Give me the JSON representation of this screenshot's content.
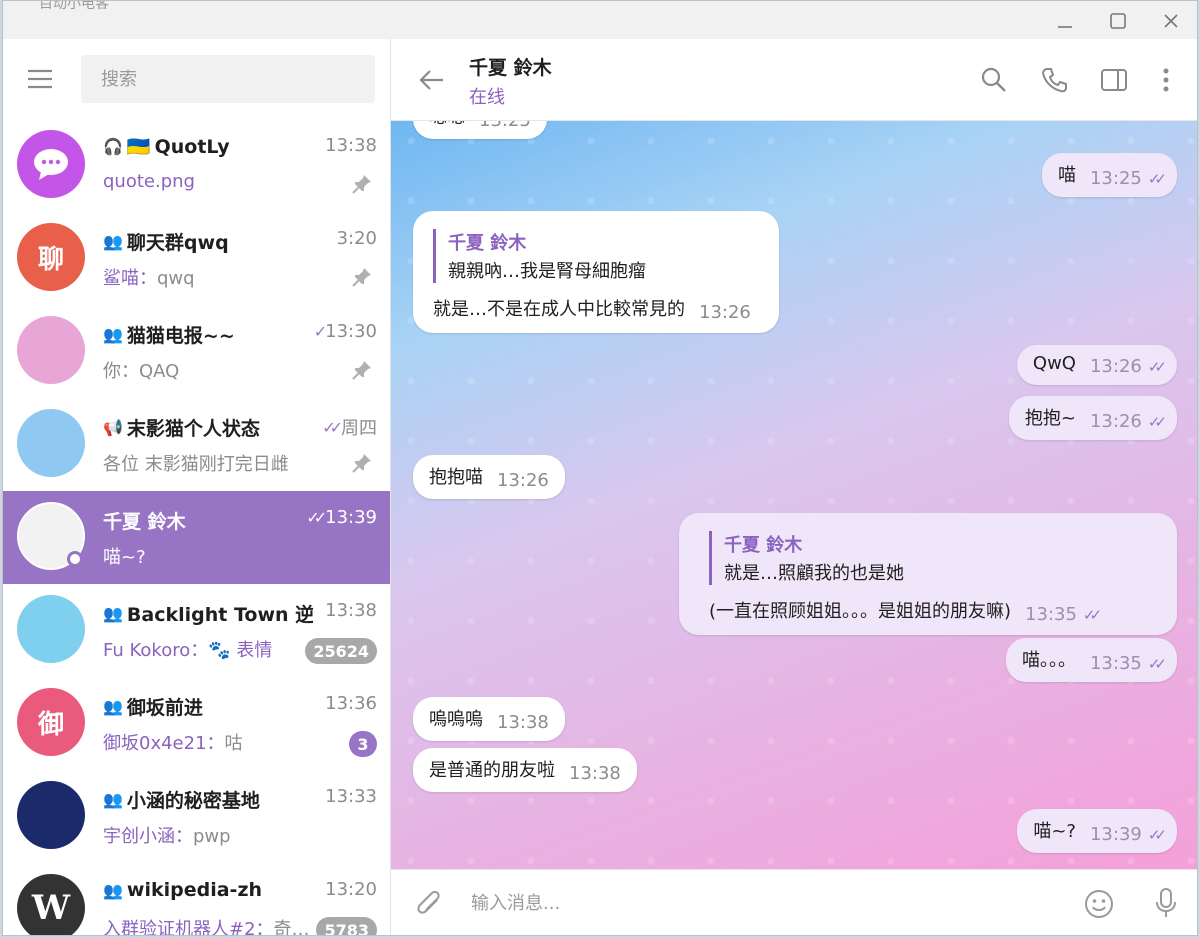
{
  "window": {
    "ghost_title": "目动小电客"
  },
  "sidebar": {
    "search_placeholder": "搜索",
    "chats": [
      {
        "name": "QuotLy",
        "name_prefix": "🇺🇦",
        "type": "bot",
        "time": "13:38",
        "preview_sender": "",
        "preview": "quote.png",
        "preview_colored": true,
        "pinned": true,
        "badge": "",
        "avatar_text": "",
        "avatar_color": "#c356e8",
        "check": ""
      },
      {
        "name": "聊天群qwq",
        "name_prefix": "",
        "type": "group",
        "time": "3:20",
        "preview_sender": "鲨喵：",
        "preview": "qwq",
        "pinned": true,
        "badge": "",
        "avatar_text": "聊",
        "avatar_color": "#e8604a",
        "check": ""
      },
      {
        "name": "猫猫电报~~",
        "name_prefix": "",
        "type": "group",
        "time": "13:30",
        "preview_sender": "",
        "preview": "你：QAQ",
        "pinned": true,
        "badge": "",
        "avatar_text": "",
        "avatar_color": "#e8a6d6",
        "check": "✓"
      },
      {
        "name": "末影猫个人状态",
        "name_prefix": "",
        "type": "channel",
        "time": "周四",
        "preview_sender": "",
        "preview": "各位 末影猫刚打完日雌",
        "pinned": true,
        "badge": "",
        "avatar_text": "",
        "avatar_color": "#8fc8f0",
        "check": "✓✓"
      },
      {
        "name": "千夏 鈴木",
        "name_prefix": "",
        "type": "user",
        "time": "13:39",
        "preview_sender": "",
        "preview": "喵~?",
        "pinned": false,
        "badge": "",
        "avatar_text": "",
        "avatar_color": "#f2f2f2",
        "check": "✓✓",
        "active": true
      },
      {
        "name": "Backlight Town 逆光小镇",
        "name_prefix": "",
        "type": "group",
        "time": "13:38",
        "preview_sender": "Fu Kokoro：",
        "preview": "🐾 表情",
        "preview_colored": true,
        "pinned": false,
        "badge": "25624",
        "avatar_text": "",
        "avatar_color": "#7fd0ee",
        "check": ""
      },
      {
        "name": "御坂前进",
        "name_prefix": "",
        "type": "group",
        "time": "13:36",
        "preview_sender": "御坂0x4e21：",
        "preview": "咕",
        "pinned": false,
        "badge": "3",
        "badge_purple": true,
        "avatar_text": "御",
        "avatar_color": "#e95a7c",
        "check": ""
      },
      {
        "name": "小涵的秘密基地",
        "name_prefix": "",
        "type": "group",
        "time": "13:33",
        "preview_sender": "宇创小涵：",
        "preview": "pwp",
        "pinned": false,
        "badge": "",
        "avatar_text": "",
        "avatar_color": "#1b2a6b",
        "check": ""
      },
      {
        "name": "wikipedia-zh",
        "name_prefix": "",
        "type": "group",
        "time": "13:20",
        "preview_sender": "入群验证机器人#2：",
        "preview": "奇…",
        "pinned": false,
        "badge": "5783",
        "avatar_text": "W",
        "avatar_color": "#333333",
        "check": ""
      }
    ]
  },
  "header": {
    "name": "千夏 鈴木",
    "status": "在线"
  },
  "messages": [
    {
      "dir": "in",
      "text": "嗯嗯",
      "time": "13:25"
    },
    {
      "dir": "out",
      "text": "喵",
      "time": "13:25"
    },
    {
      "dir": "in",
      "reply_name": "千夏 鈴木",
      "reply_text": "親親吶…我是腎母細胞瘤",
      "text": "就是…不是在成人中比較常見的",
      "time": "13:26"
    },
    {
      "dir": "out",
      "text": "QwQ",
      "time": "13:26"
    },
    {
      "dir": "out",
      "text": "抱抱~",
      "time": "13:26"
    },
    {
      "dir": "in",
      "text": "抱抱喵",
      "time": "13:26"
    },
    {
      "dir": "out",
      "reply_name": "千夏 鈴木",
      "reply_text": "就是…照顧我的也是她",
      "text": "(一直在照顾姐姐。。。是姐姐的朋友嘛)",
      "time": "13:35"
    },
    {
      "dir": "out",
      "text": "喵。。。",
      "time": "13:35"
    },
    {
      "dir": "in",
      "text": "嗚嗚嗚",
      "time": "13:38"
    },
    {
      "dir": "in",
      "text": "是普通的朋友啦",
      "time": "13:38"
    },
    {
      "dir": "out",
      "text": "喵~?",
      "time": "13:39"
    }
  ],
  "composer": {
    "placeholder": "输入消息..."
  },
  "colors": {
    "accent": "#9875c4",
    "link": "#8b62bf",
    "out_bubble": "#efe7f9"
  }
}
